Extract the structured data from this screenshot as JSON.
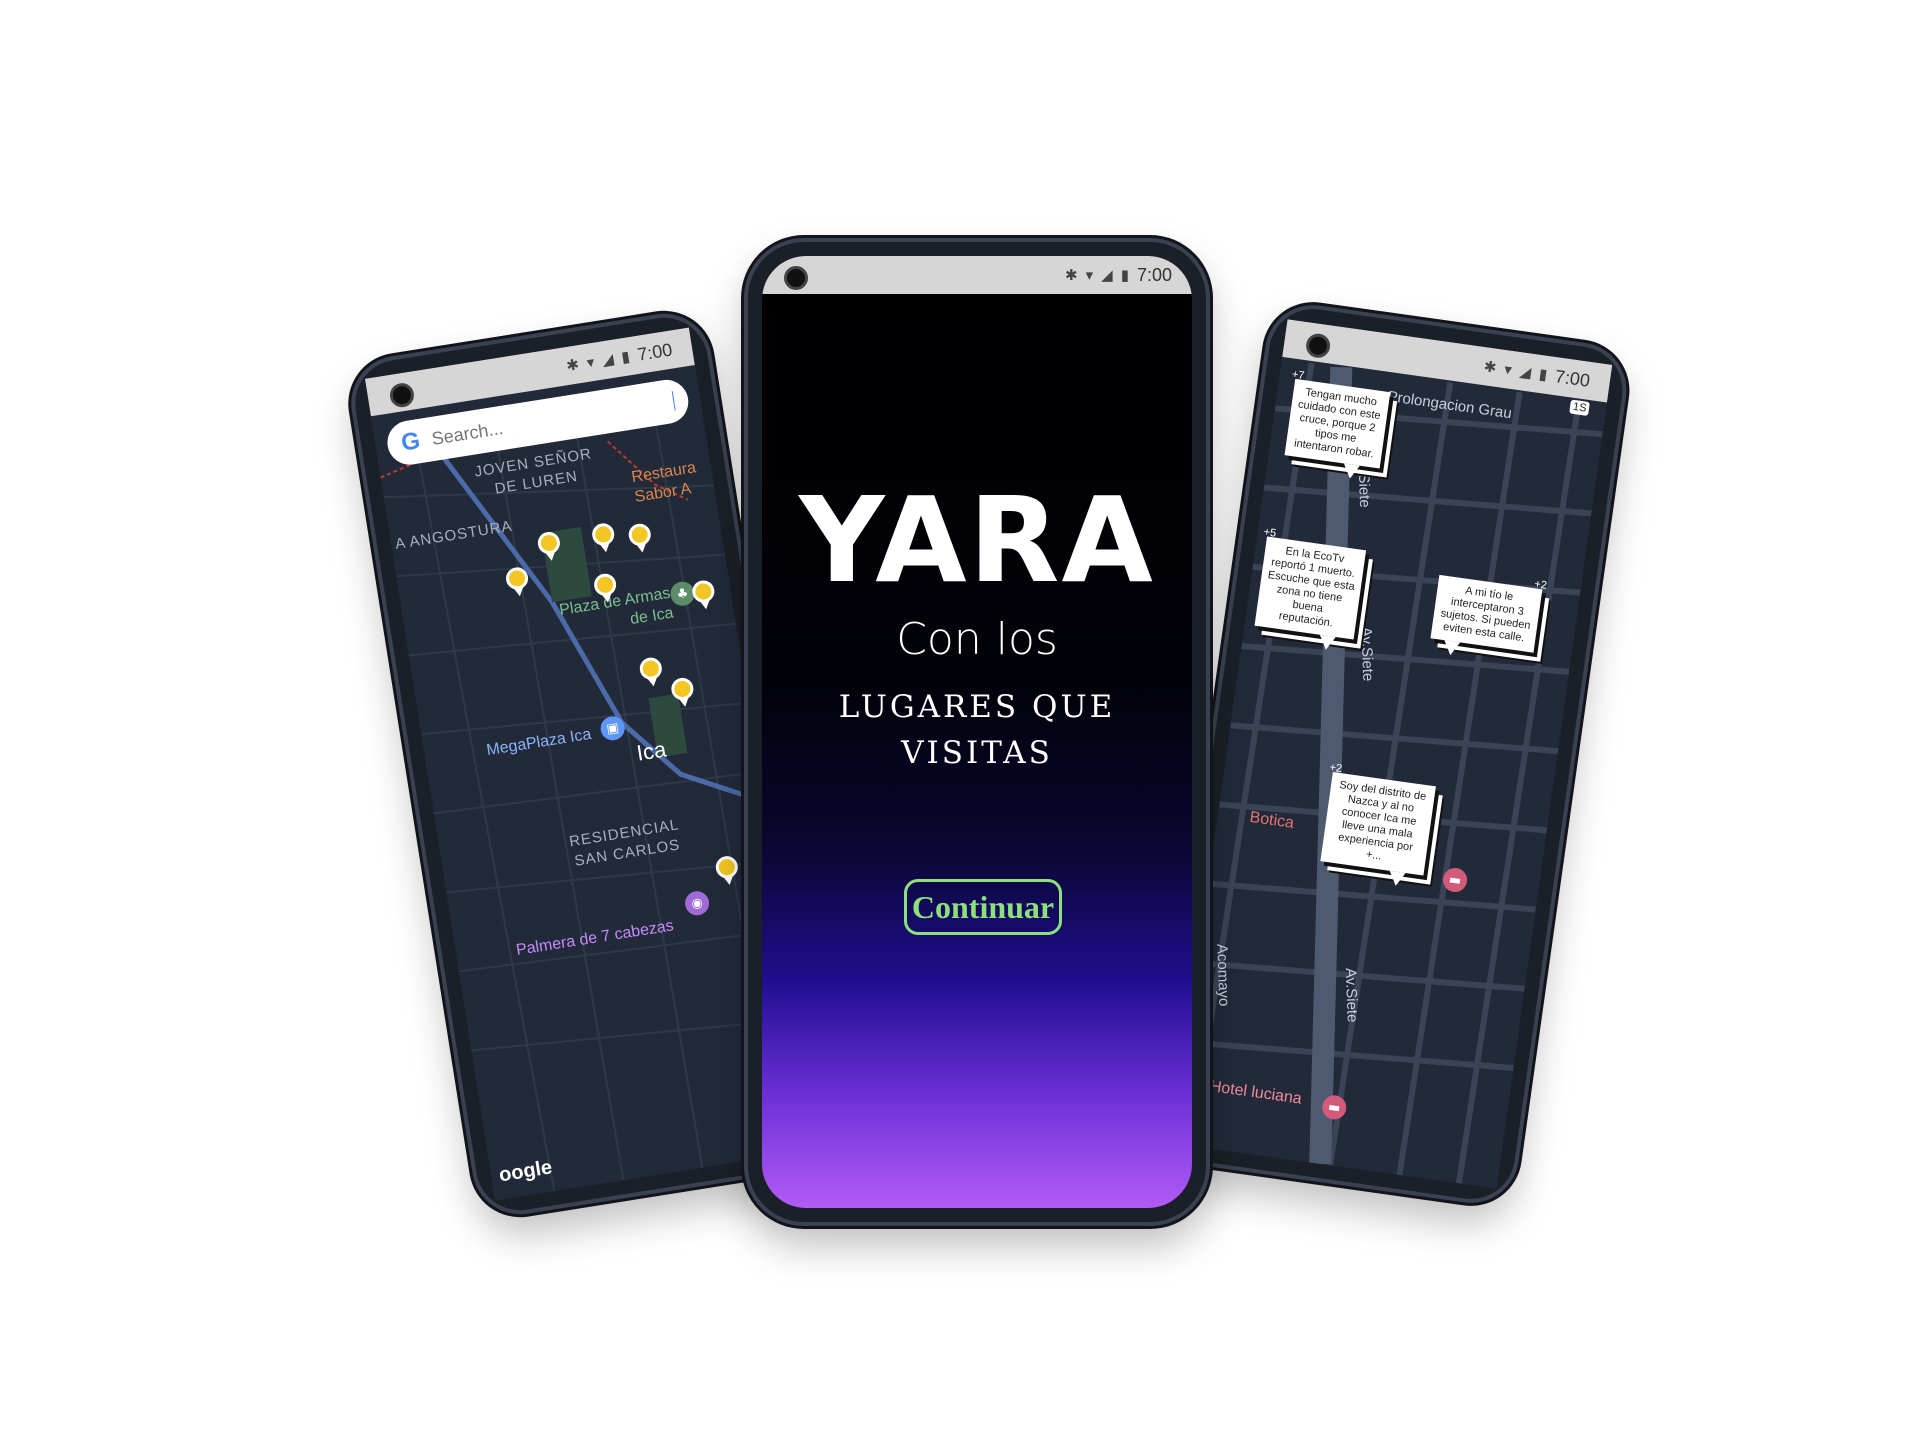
{
  "status_bar": {
    "time": "7:00",
    "network": "LTE"
  },
  "left_phone": {
    "search": {
      "placeholder": "Search..."
    },
    "labels": {
      "joven": "JOVEN SEÑOR DE LUREN",
      "angostura": "A ANGOSTURA",
      "restaurant": "Restaura Sabor A",
      "plaza": "Plaza de Armas de Ica",
      "megaplaza": "MegaPlaza Ica",
      "city": "Ica",
      "residencial": "RESIDENCIAL SAN CARLOS",
      "palmera": "Palmera de 7 cabezas",
      "google": "oogle"
    }
  },
  "center_phone": {
    "title": "YARA",
    "subtitle_line1": "Con los",
    "subtitle_line2": "LUGARES QUE VISITAS",
    "continue_label": "Continuar",
    "colors": {
      "button": "#8ee07b",
      "gradient_end": "#b25bf5"
    }
  },
  "right_phone": {
    "streets": {
      "grau": "Prolongacion Grau",
      "siete_1": "Av Siete",
      "siete_2": "Av.Siete",
      "siete_3": "Av.Siete",
      "acomayo": "Acomayo",
      "route": "1S"
    },
    "places": {
      "botica": "Botica",
      "hotel": "Hotel luciana"
    },
    "bubbles": [
      {
        "count": "+7",
        "text": "Tengan mucho cuidado con este cruce, porque 2 tipos me intentaron robar."
      },
      {
        "count": "+5",
        "text": "En la EcoTv reportó 1 muerto. Escuche que esta zona no tiene buena reputación."
      },
      {
        "count": "+2",
        "text": "A mi tío le interceptaron 3 sujetos. Si pueden eviten esta calle."
      },
      {
        "count": "+2",
        "text": "Soy del distrito de Nazca y al no conocer Ica me lleve una mala experiencia por +..."
      }
    ]
  }
}
